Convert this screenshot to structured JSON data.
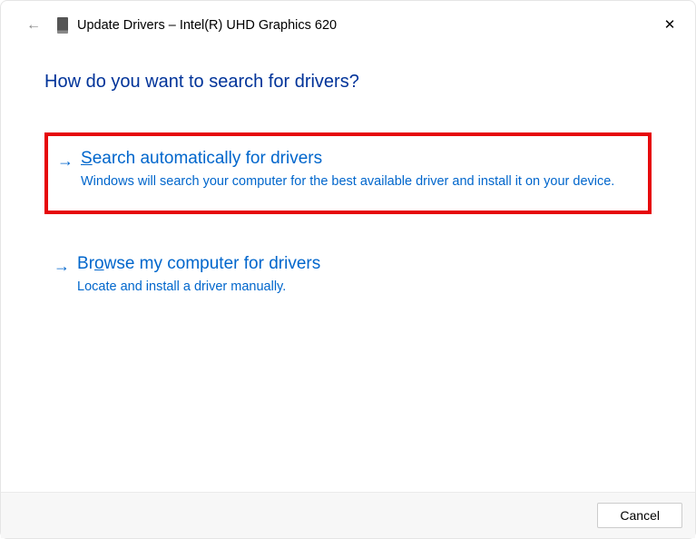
{
  "titlebar": {
    "title": "Update Drivers – Intel(R) UHD Graphics 620"
  },
  "heading": "How do you want to search for drivers?",
  "options": [
    {
      "first_char": "S",
      "rest": "earch automatically for drivers",
      "desc": "Windows will search your computer for the best available driver and install it on your device."
    },
    {
      "first_char": "B",
      "rest_before_underline": "r",
      "underline_char": "o",
      "rest_after": "wse my computer for drivers",
      "desc": "Locate and install a driver manually."
    }
  ],
  "footer": {
    "cancel": "Cancel"
  }
}
